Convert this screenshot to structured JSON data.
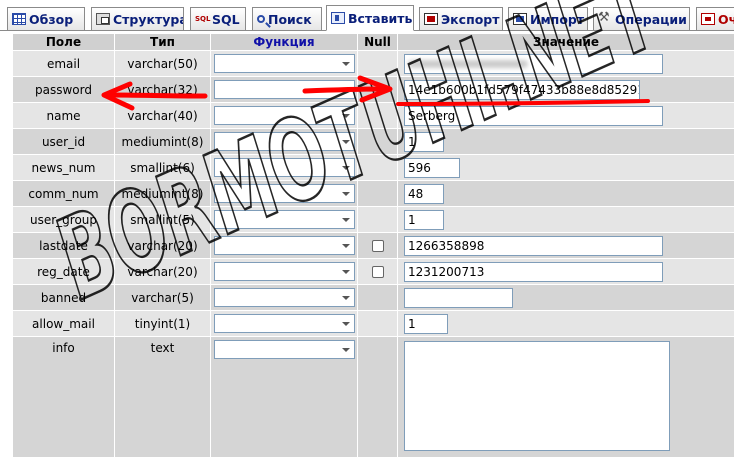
{
  "tabs": [
    {
      "label": "Обзор",
      "icon": "browse-icon"
    },
    {
      "label": "Структура",
      "icon": "structure-icon"
    },
    {
      "label": "SQL",
      "icon": "sql-icon"
    },
    {
      "label": "Поиск",
      "icon": "search-icon"
    },
    {
      "label": "Вставить",
      "icon": "insert-icon"
    },
    {
      "label": "Экспорт",
      "icon": "export-icon"
    },
    {
      "label": "Импорт",
      "icon": "import-icon"
    },
    {
      "label": "Операции",
      "icon": "operations-icon"
    },
    {
      "label": "Оч",
      "icon": "empty-icon"
    }
  ],
  "active_tab": "Вставить",
  "table": {
    "headers": {
      "field": "Поле",
      "type": "Тип",
      "function": "Функция",
      "null": "Null",
      "value": "Значение"
    },
    "rows": [
      {
        "field": "email",
        "type": "varchar(50)",
        "value": "",
        "null_checkbox": false,
        "value_blurred": true
      },
      {
        "field": "password",
        "type": "varchar(32)",
        "value": "14e1b600b1fd579f47433b88e8d85291",
        "null_checkbox": false
      },
      {
        "field": "name",
        "type": "varchar(40)",
        "value": "Serberg",
        "null_checkbox": false
      },
      {
        "field": "user_id",
        "type": "mediumint(8)",
        "value": "1",
        "null_checkbox": false
      },
      {
        "field": "news_num",
        "type": "smallint(6)",
        "value": "596",
        "null_checkbox": false
      },
      {
        "field": "comm_num",
        "type": "mediumint(8)",
        "value": "48",
        "null_checkbox": false
      },
      {
        "field": "user_group",
        "type": "smallint(5)",
        "value": "1",
        "null_checkbox": false
      },
      {
        "field": "lastdate",
        "type": "varchar(20)",
        "value": "1266358898",
        "null_checkbox": true
      },
      {
        "field": "reg_date",
        "type": "varchar(20)",
        "value": "1231200713",
        "null_checkbox": true
      },
      {
        "field": "banned",
        "type": "varchar(5)",
        "value": "",
        "null_checkbox": false
      },
      {
        "field": "allow_mail",
        "type": "tinyint(1)",
        "value": "1",
        "null_checkbox": false
      },
      {
        "field": "info",
        "type": "text",
        "value": "",
        "null_checkbox": false,
        "textarea": true
      }
    ]
  },
  "watermark": "BORMOTUHI.NET",
  "annotation_color": "#ff0000"
}
